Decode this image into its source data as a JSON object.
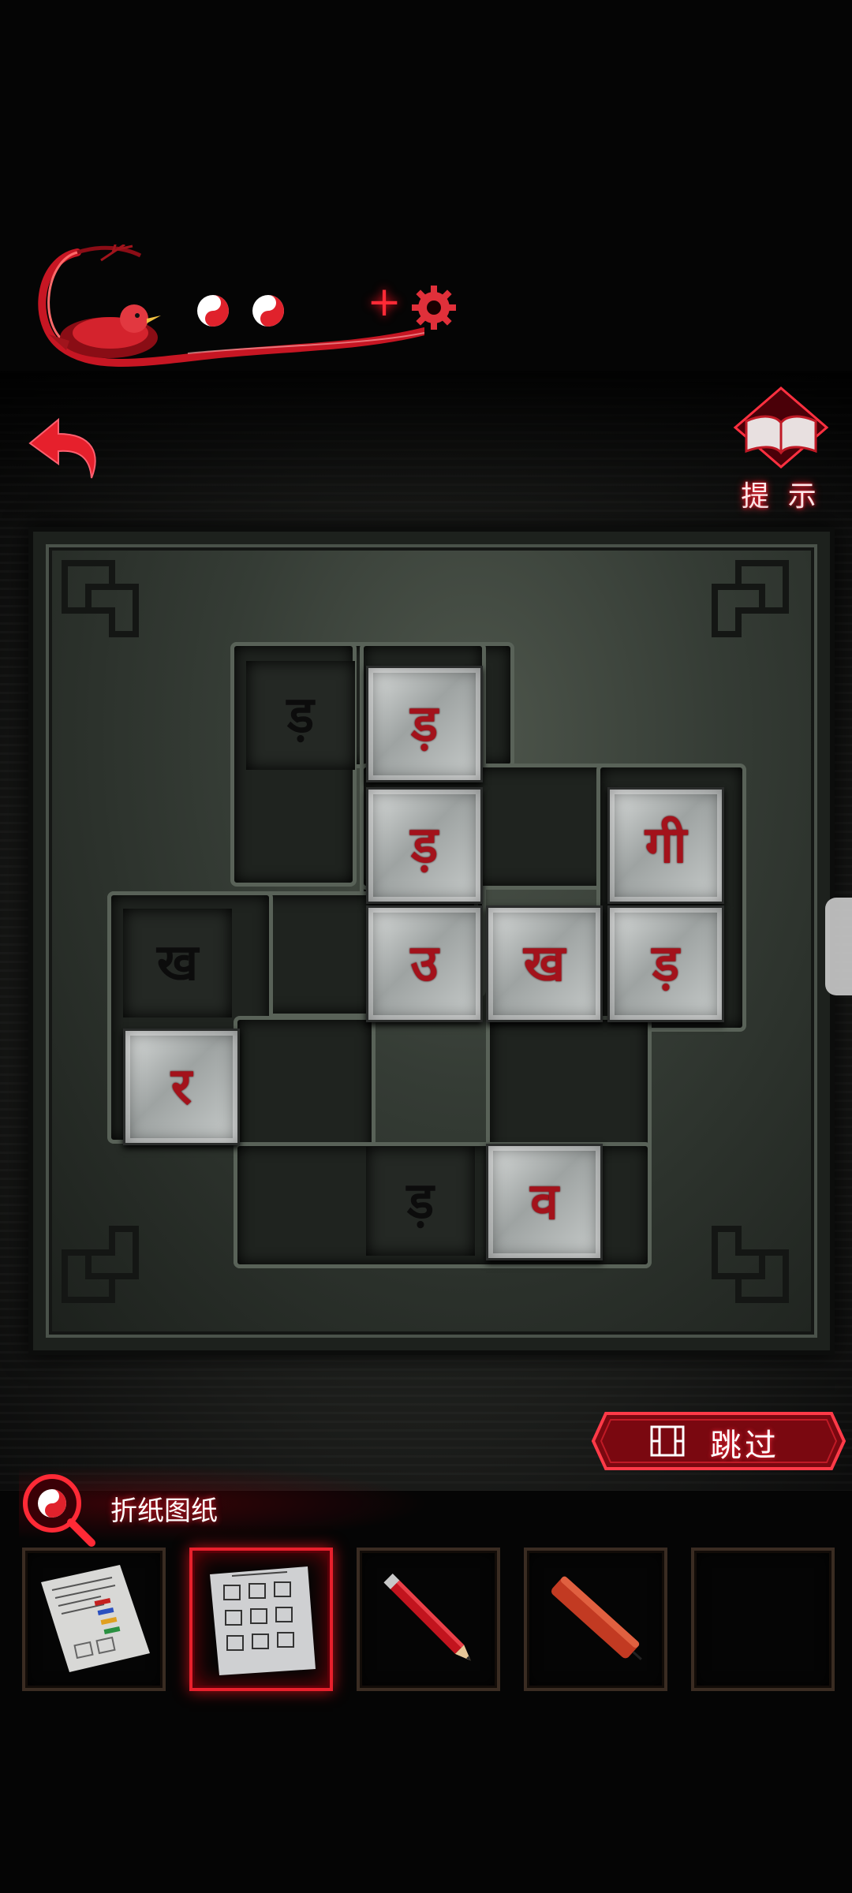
{
  "status_bar": {
    "yin_yang_tokens": 2,
    "plus_label": "+",
    "accent_color": "#ff2a36"
  },
  "top_controls": {
    "back_icon": "undo-arrow-icon",
    "hint_icon": "book-icon",
    "hint_label": "提 示"
  },
  "puzzle": {
    "slots": [
      {
        "id": "r0c1",
        "glyph": "ड़"
      },
      {
        "id": "r2c0",
        "glyph": "ख"
      },
      {
        "id": "r4c2",
        "glyph": "ड़"
      }
    ],
    "tiles": [
      {
        "id": "t1",
        "glyph": "ड़"
      },
      {
        "id": "t2",
        "glyph": "ड़"
      },
      {
        "id": "t3",
        "glyph": "गी"
      },
      {
        "id": "t4",
        "glyph": "उ"
      },
      {
        "id": "t5",
        "glyph": "ख"
      },
      {
        "id": "t6",
        "glyph": "ड़"
      },
      {
        "id": "t7",
        "glyph": "र"
      },
      {
        "id": "t8",
        "glyph": "व"
      }
    ]
  },
  "skip_button": {
    "icon": "film-icon",
    "label": "跳过"
  },
  "selected_item": {
    "icon": "magnifier-yin-yang-icon",
    "name": "折纸图纸"
  },
  "inventory": [
    {
      "item": "paper-notes-icon",
      "selected": false
    },
    {
      "item": "folding-paper-diagram-icon",
      "selected": true
    },
    {
      "item": "red-pencil-icon",
      "selected": false
    },
    {
      "item": "red-candle-icon",
      "selected": false
    },
    {
      "item": "empty-slot",
      "selected": false
    }
  ]
}
